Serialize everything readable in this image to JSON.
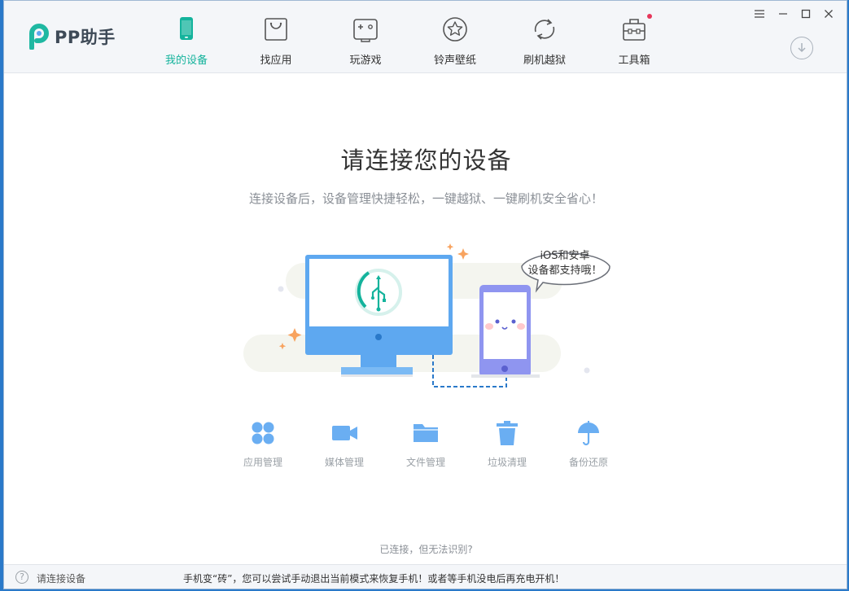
{
  "app": {
    "logo_text": "PP助手",
    "accent": "#14b39c"
  },
  "nav": [
    {
      "label": "我的设备",
      "icon": "phone-icon",
      "active": true
    },
    {
      "label": "找应用",
      "icon": "shopping-bag-icon"
    },
    {
      "label": "玩游戏",
      "icon": "gamepad-icon"
    },
    {
      "label": "铃声壁纸",
      "icon": "star-icon"
    },
    {
      "label": "刷机越狱",
      "icon": "refresh-icon"
    },
    {
      "label": "工具箱",
      "icon": "toolbox-icon",
      "badge": true
    }
  ],
  "window_controls": [
    "menu-icon",
    "minimize-icon",
    "maximize-icon",
    "close-icon"
  ],
  "main": {
    "title": "请连接您的设备",
    "subtitle": "连接设备后，设备管理快捷轻松，一键越狱、一键刷机安全省心！",
    "bubble_line1": "iOS和安卓",
    "bubble_line2": "设备都支持哦！",
    "help_link": "已连接，但无法识别?"
  },
  "features": [
    {
      "label": "应用管理",
      "icon": "grid-icon"
    },
    {
      "label": "媒体管理",
      "icon": "video-camera-icon"
    },
    {
      "label": "文件管理",
      "icon": "folder-icon"
    },
    {
      "label": "垃圾清理",
      "icon": "trash-icon"
    },
    {
      "label": "备份还原",
      "icon": "umbrella-icon"
    }
  ],
  "status": {
    "text": "请连接设备",
    "tip": "手机变“砖”，您可以尝试手动退出当前模式来恢复手机！或者等手机没电后再充电开机！"
  }
}
